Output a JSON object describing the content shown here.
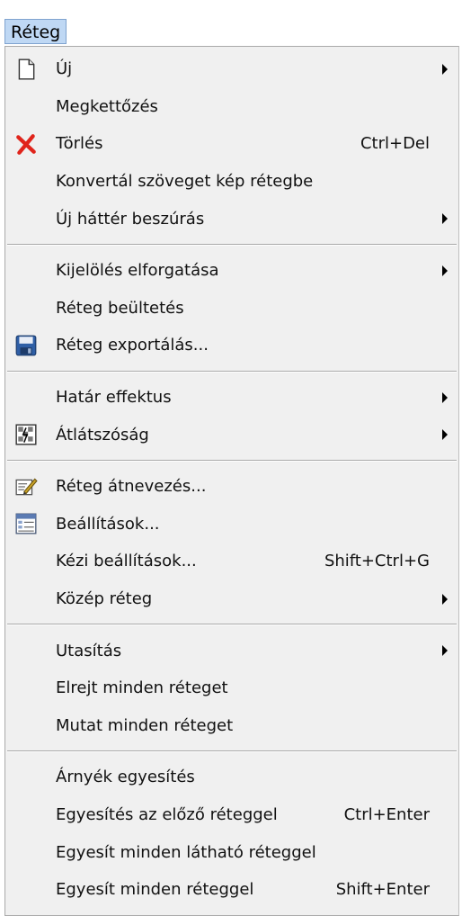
{
  "menubar": {
    "title": "Réteg"
  },
  "menu": {
    "groups": [
      {
        "items": [
          {
            "label": "Új",
            "shortcut": "",
            "submenu": true,
            "icon": "document-icon"
          },
          {
            "label": "Megkettőzés",
            "shortcut": "",
            "submenu": false,
            "icon": ""
          },
          {
            "label": "Törlés",
            "shortcut": "Ctrl+Del",
            "submenu": false,
            "icon": "delete-x-icon"
          },
          {
            "label": "Konvertál szöveget kép rétegbe",
            "shortcut": "",
            "submenu": false,
            "icon": ""
          },
          {
            "label": "Új háttér beszúrás",
            "shortcut": "",
            "submenu": true,
            "icon": ""
          }
        ]
      },
      {
        "items": [
          {
            "label": "Kijelölés elforgatása",
            "shortcut": "",
            "submenu": true,
            "icon": ""
          },
          {
            "label": "Réteg beültetés",
            "shortcut": "",
            "submenu": false,
            "icon": ""
          },
          {
            "label": "Réteg exportálás...",
            "shortcut": "",
            "submenu": false,
            "icon": "floppy-disk-icon"
          }
        ]
      },
      {
        "items": [
          {
            "label": "Határ effektus",
            "shortcut": "",
            "submenu": true,
            "icon": ""
          },
          {
            "label": "Átlátszóság",
            "shortcut": "",
            "submenu": true,
            "icon": "transparency-icon"
          }
        ]
      },
      {
        "items": [
          {
            "label": "Réteg átnevezés...",
            "shortcut": "",
            "submenu": false,
            "icon": "rename-pencil-icon"
          },
          {
            "label": "Beállítások...",
            "shortcut": "",
            "submenu": false,
            "icon": "properties-window-icon"
          },
          {
            "label": "Kézi beállítások...",
            "shortcut": "Shift+Ctrl+G",
            "submenu": false,
            "icon": ""
          },
          {
            "label": "Közép réteg",
            "shortcut": "",
            "submenu": true,
            "icon": ""
          }
        ]
      },
      {
        "items": [
          {
            "label": "Utasítás",
            "shortcut": "",
            "submenu": true,
            "icon": ""
          },
          {
            "label": "Elrejt minden réteget",
            "shortcut": "",
            "submenu": false,
            "icon": ""
          },
          {
            "label": "Mutat minden réteget",
            "shortcut": "",
            "submenu": false,
            "icon": ""
          }
        ]
      },
      {
        "items": [
          {
            "label": "Árnyék egyesítés",
            "shortcut": "",
            "submenu": false,
            "icon": ""
          },
          {
            "label": "Egyesítés az előző réteggel",
            "shortcut": "Ctrl+Enter",
            "submenu": false,
            "icon": ""
          },
          {
            "label": "Egyesít minden látható réteggel",
            "shortcut": "",
            "submenu": false,
            "icon": ""
          },
          {
            "label": "Egyesít minden réteggel",
            "shortcut": "Shift+Enter",
            "submenu": false,
            "icon": ""
          }
        ]
      }
    ]
  }
}
